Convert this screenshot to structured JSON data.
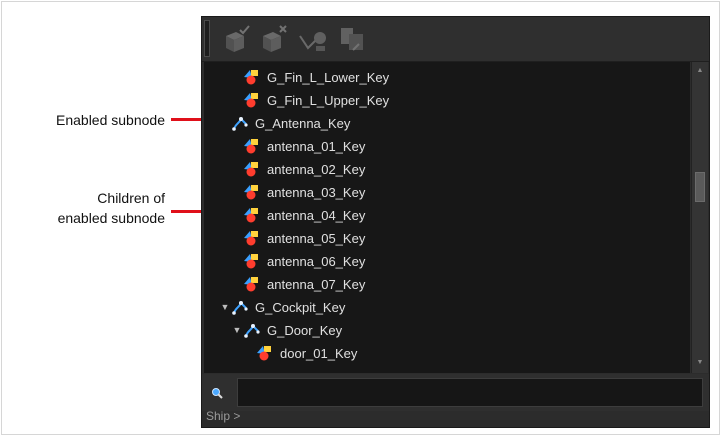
{
  "annotations": {
    "enabled_subnode": "Enabled subnode",
    "children_line1": "Children of",
    "children_line2": "enabled subnode"
  },
  "toolbar": {
    "buttons": [
      {
        "name": "add-keyframe-icon"
      },
      {
        "name": "remove-keyframe-icon"
      },
      {
        "name": "reset-pose-icon"
      },
      {
        "name": "export-icon"
      }
    ]
  },
  "tree": {
    "rows": [
      {
        "label": "G_Fin_L_Lower_Key",
        "type": "drawing",
        "depth": 2,
        "expanded": null
      },
      {
        "label": "G_Fin_L_Upper_Key",
        "type": "drawing",
        "depth": 2,
        "expanded": null
      },
      {
        "label": "G_Antenna_Key",
        "type": "group",
        "depth": 1,
        "expanded": false
      },
      {
        "label": "antenna_01_Key",
        "type": "drawing",
        "depth": 2,
        "expanded": null
      },
      {
        "label": "antenna_02_Key",
        "type": "drawing",
        "depth": 2,
        "expanded": null
      },
      {
        "label": "antenna_03_Key",
        "type": "drawing",
        "depth": 2,
        "expanded": null
      },
      {
        "label": "antenna_04_Key",
        "type": "drawing",
        "depth": 2,
        "expanded": null
      },
      {
        "label": "antenna_05_Key",
        "type": "drawing",
        "depth": 2,
        "expanded": null
      },
      {
        "label": "antenna_06_Key",
        "type": "drawing",
        "depth": 2,
        "expanded": null
      },
      {
        "label": "antenna_07_Key",
        "type": "drawing",
        "depth": 2,
        "expanded": null
      },
      {
        "label": "G_Cockpit_Key",
        "type": "group",
        "depth": 1,
        "expanded": true
      },
      {
        "label": "G_Door_Key",
        "type": "group",
        "depth": 2,
        "expanded": true
      },
      {
        "label": "door_01_Key",
        "type": "drawing",
        "depth": 3,
        "expanded": null
      }
    ]
  },
  "search": {
    "value": "",
    "placeholder": ""
  },
  "status": {
    "breadcrumb": "Ship >"
  },
  "colors": {
    "callout": "#e0101a",
    "panel": "#2c2c2c",
    "tree_bg": "#171717",
    "text": "#e0e0e0"
  }
}
